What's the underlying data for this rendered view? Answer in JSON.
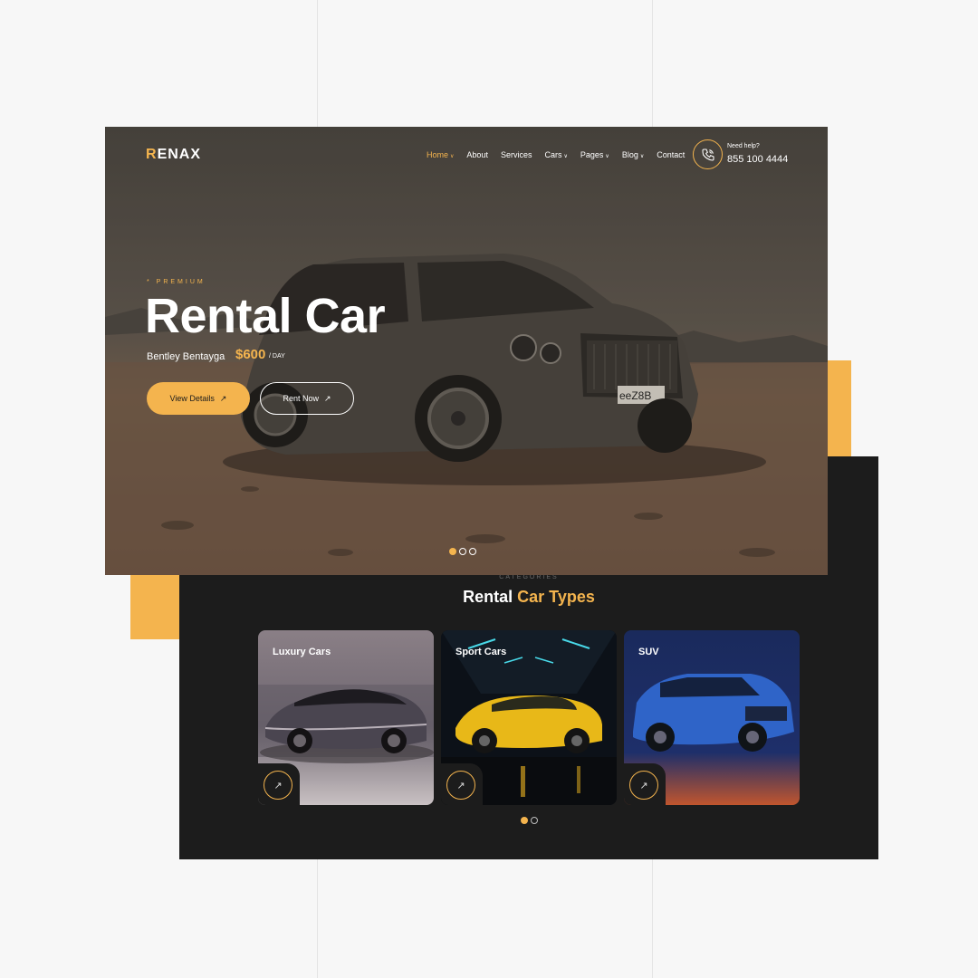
{
  "brand": {
    "logo_first": "R",
    "logo_rest": "ENAX"
  },
  "nav": {
    "items": [
      {
        "label": "Home",
        "dropdown": true,
        "active": true
      },
      {
        "label": "About",
        "dropdown": false
      },
      {
        "label": "Services",
        "dropdown": false
      },
      {
        "label": "Cars",
        "dropdown": true
      },
      {
        "label": "Pages",
        "dropdown": true
      },
      {
        "label": "Blog",
        "dropdown": true
      },
      {
        "label": "Contact",
        "dropdown": false
      }
    ]
  },
  "help": {
    "label": "Need help?",
    "phone": "855 100 4444",
    "icon": "phone-icon"
  },
  "hero": {
    "eyebrow": "* PREMIUM",
    "title": "Rental Car",
    "model": "Bentley Bentayga",
    "price": "$600",
    "per": "/ DAY",
    "plate": "eeZ8B",
    "primary_button": "View Details",
    "secondary_button": "Rent Now",
    "slides": 3,
    "active_slide": 1
  },
  "categories": {
    "eyebrow": "CATEGORIES",
    "title_plain": "Rental ",
    "title_accent": "Car Types",
    "items": [
      {
        "label": "Luxury Cars",
        "icon": "arrow-up-right-icon"
      },
      {
        "label": "Sport Cars",
        "icon": "arrow-up-right-icon"
      },
      {
        "label": "SUV",
        "icon": "arrow-up-right-icon"
      }
    ],
    "pages": 2,
    "active_page": 1
  },
  "colors": {
    "accent": "#f4b44e",
    "dark": "#1c1c1c",
    "background": "#f7f7f7"
  }
}
